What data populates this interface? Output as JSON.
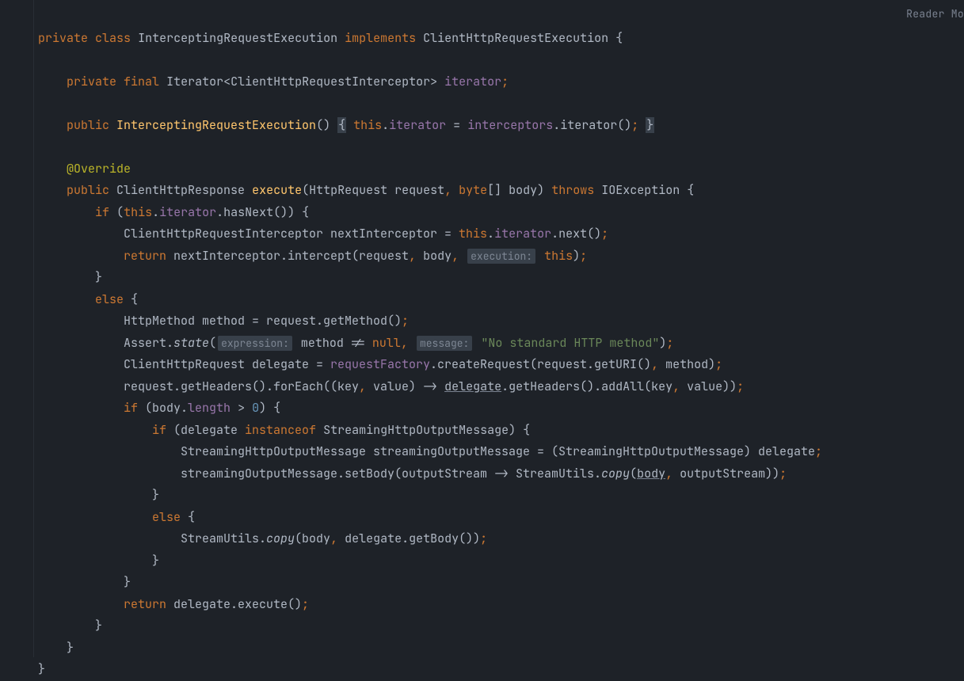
{
  "reader_mode_label": "Reader Mo",
  "code": {
    "l1": {
      "private": "private",
      "class": "class",
      "name": "InterceptingRequestExecution",
      "implements": "implements",
      "iface": "ClientHttpRequestExecution",
      "ob": "{"
    },
    "l3": {
      "private": "private",
      "final": "final",
      "type": "Iterator<ClientHttpRequestInterceptor>",
      "field": "iterator",
      "term": ";"
    },
    "l5": {
      "public": "public",
      "ctor": "InterceptingRequestExecution",
      "paren": "()",
      "ob": "{",
      "this": "this",
      "dot": ".",
      "field": "iterator",
      "eq": " = ",
      "call": "interceptors",
      "dot2": ".",
      "m": "iterator()",
      "semi": ";",
      "cb": "}"
    },
    "l7": {
      "ann": "@Override"
    },
    "l8": {
      "public": "public",
      "ret": "ClientHttpResponse",
      "name": "execute",
      "sig1": "(HttpRequest request",
      "c1": ",",
      "byte": "byte",
      "arr": "[] body)",
      "throws": "throws",
      "exc": "IOException {"
    },
    "l9": {
      "if": "if",
      "open": "(",
      "this": "this",
      "dot": ".",
      "it": "iterator",
      "rest": ".hasNext()) {"
    },
    "l10": {
      "txt1": "ClientHttpRequestInterceptor nextInterceptor = ",
      "this": "this",
      "dot": ".",
      "it": "iterator",
      "rest": ".next()",
      "semi": ";"
    },
    "l11": {
      "return": "return",
      "txt": " nextInterceptor.intercept(request",
      "c1": ",",
      "b": " body",
      "c2": ",",
      "hint": "execution:",
      "this": "this",
      "close": ")",
      "semi": ";"
    },
    "l12": {
      "cb": "}"
    },
    "l13": {
      "else": "else",
      "ob": " {"
    },
    "l14": {
      "txt": "HttpMethod method = request.getMethod()",
      "semi": ";"
    },
    "l15": {
      "assert": "Assert.",
      "state": "state",
      "open": "(",
      "hint1": "expression:",
      "mid": " method != ",
      "null": "null",
      "c": ",",
      "hint2": "message:",
      "str": "\"No standard HTTP method\"",
      "close": ")",
      "semi": ";"
    },
    "l16": {
      "txt1": "ClientHttpRequest delegate = ",
      "rf": "requestFactory",
      "txt2": ".createRequest(request.getURI()",
      "c": ",",
      "txt3": " method)",
      "semi": ";"
    },
    "l17": {
      "txt1": "request.getHeaders().forEach((key",
      "c1": ",",
      "txt2": " value) -> ",
      "deleg": "delegate",
      "txt3": ".getHeaders().addAll(key",
      "c2": ",",
      "txt4": " value))",
      "semi": ";"
    },
    "l18": {
      "if": "if",
      "open": " (body.",
      "len": "length",
      "gt": " > ",
      "zero": "0",
      "close": ") {"
    },
    "l19": {
      "if": "if",
      "open": " (delegate ",
      "inst": "instanceof",
      "rest": " StreamingHttpOutputMessage) {"
    },
    "l20": {
      "txt": "StreamingHttpOutputMessage streamingOutputMessage = (StreamingHttpOutputMessage) delegate",
      "semi": ";"
    },
    "l21": {
      "txt1": "streamingOutputMessage.setBody(outputStream -> StreamUtils.",
      "copy": "copy",
      "open": "(",
      "body": "body",
      "c": ",",
      "txt2": " outputStream))",
      "semi": ";"
    },
    "l22": {
      "cb": "}"
    },
    "l23": {
      "else": "else",
      "ob": " {"
    },
    "l24": {
      "txt1": "StreamUtils.",
      "copy": "copy",
      "txt2": "(body",
      "c": ",",
      "txt3": " delegate.getBody())",
      "semi": ";"
    },
    "l25": {
      "cb": "}"
    },
    "l26": {
      "cb": "}"
    },
    "l27": {
      "return": "return",
      "txt": " delegate.execute()",
      "semi": ";"
    },
    "l28": {
      "cb": "}"
    },
    "l29": {
      "cb": "}"
    },
    "l30": {
      "cb": "}"
    }
  }
}
